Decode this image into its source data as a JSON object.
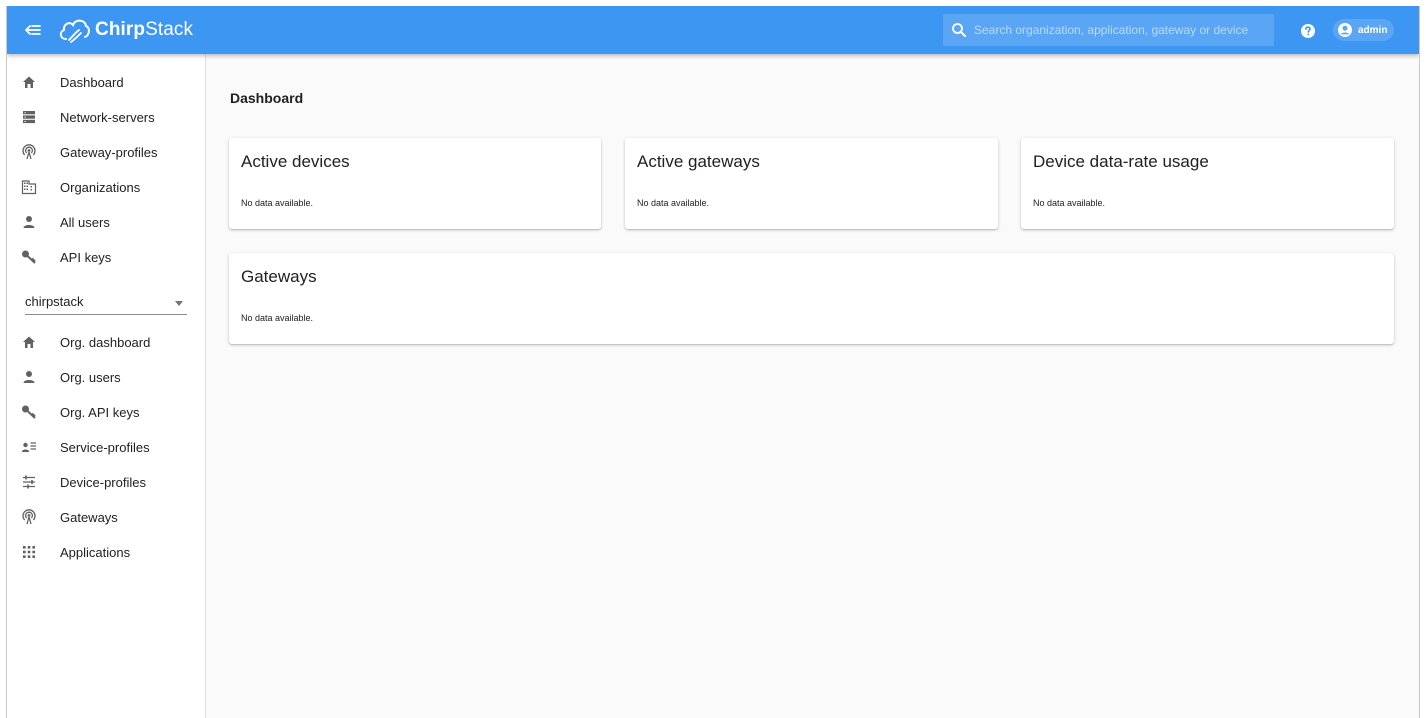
{
  "app": {
    "brand_bold": "Chirp",
    "brand_light": "Stack",
    "accent_color": "#3e96f3"
  },
  "topbar": {
    "menu_icon": "menu-collapse-icon",
    "search_placeholder": "Search organization, application, gateway or device",
    "help_icon": "help-icon",
    "user_label": "admin",
    "user_icon": "account-circle-icon"
  },
  "sidebar": {
    "global_items": [
      {
        "label": "Dashboard",
        "icon": "home-icon"
      },
      {
        "label": "Network-servers",
        "icon": "server-icon"
      },
      {
        "label": "Gateway-profiles",
        "icon": "radio-tower-icon"
      },
      {
        "label": "Organizations",
        "icon": "domain-icon"
      },
      {
        "label": "All users",
        "icon": "account-icon"
      },
      {
        "label": "API keys",
        "icon": "key-icon"
      }
    ],
    "org_select": {
      "value": "chirpstack"
    },
    "org_items": [
      {
        "label": "Org. dashboard",
        "icon": "home-icon"
      },
      {
        "label": "Org. users",
        "icon": "account-icon"
      },
      {
        "label": "Org. API keys",
        "icon": "key-icon"
      },
      {
        "label": "Service-profiles",
        "icon": "account-details-icon"
      },
      {
        "label": "Device-profiles",
        "icon": "tune-icon"
      },
      {
        "label": "Gateways",
        "icon": "radio-tower-icon"
      },
      {
        "label": "Applications",
        "icon": "apps-icon"
      }
    ]
  },
  "main": {
    "title": "Dashboard",
    "cards": [
      {
        "title": "Active devices",
        "body": "No data available."
      },
      {
        "title": "Active gateways",
        "body": "No data available."
      },
      {
        "title": "Device data-rate usage",
        "body": "No data available."
      },
      {
        "title": "Gateways",
        "body": "No data available."
      }
    ]
  }
}
